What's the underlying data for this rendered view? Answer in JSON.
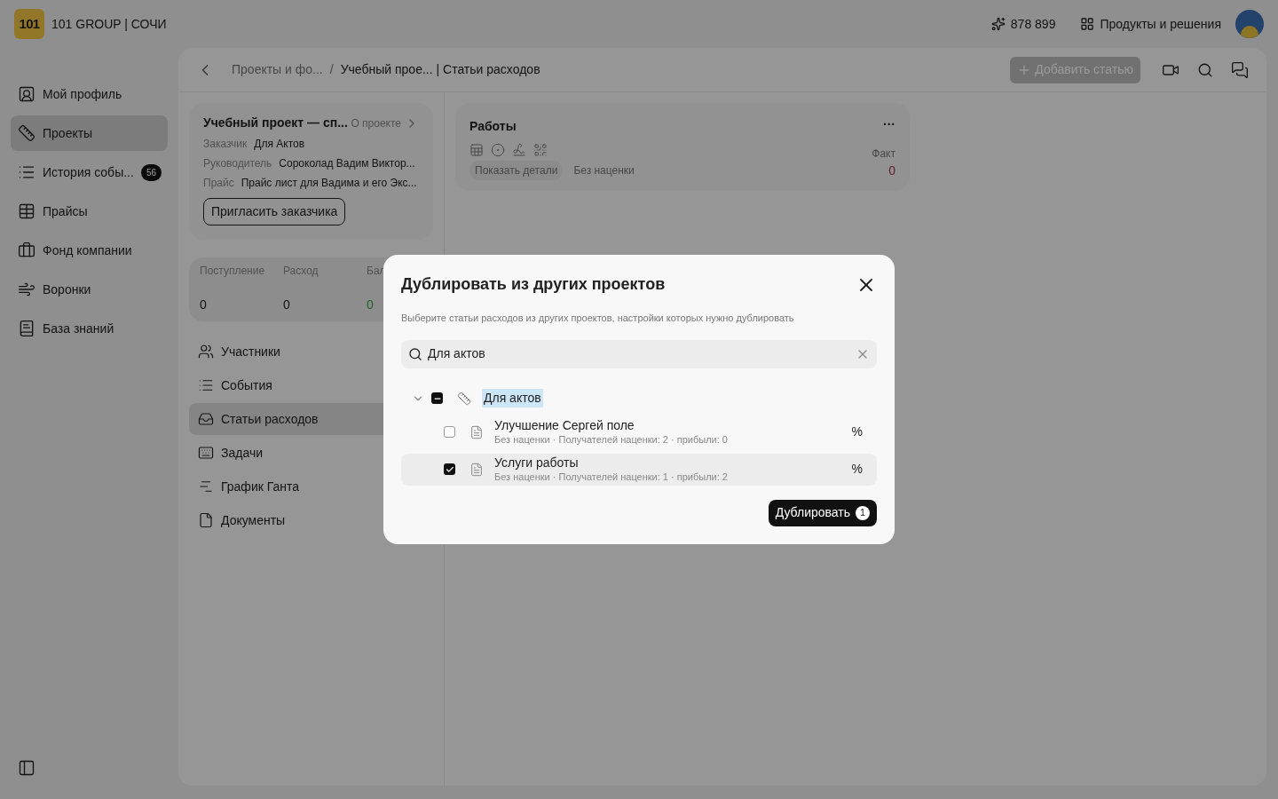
{
  "topbar": {
    "logo": "101",
    "brand": "101 GROUP | СОЧИ",
    "balance": "878 899",
    "products": "Продукты и решения"
  },
  "sidebar": {
    "items": [
      {
        "label": "Мой профиль",
        "selected": false
      },
      {
        "label": "Проекты",
        "selected": true
      },
      {
        "label": "История собы...",
        "selected": false,
        "badge": "56"
      },
      {
        "label": "Прайсы",
        "selected": false
      },
      {
        "label": "Фонд компании",
        "selected": false
      },
      {
        "label": "Воронки",
        "selected": false
      },
      {
        "label": "База знаний",
        "selected": false
      }
    ]
  },
  "header": {
    "breadcrumbs": [
      "Проекты и фо...",
      "Учебный прое... | Статьи расходов"
    ],
    "separator": "/",
    "add_button": "Добавить статью"
  },
  "project": {
    "title": "Учебный проект — сп...",
    "about": "О проекте",
    "fields": [
      {
        "label": "Заказчик",
        "value": "Для Актов"
      },
      {
        "label": "Руководитель",
        "value": "Сороколад Вадим Виктор..."
      },
      {
        "label": "Прайс",
        "value": "Прайс лист для Вадима и его Экс..."
      }
    ],
    "invite": "Пригласить заказчика"
  },
  "stats": [
    {
      "label": "Поступление",
      "value": "0",
      "kind": "plain"
    },
    {
      "label": "Расход",
      "value": "0",
      "kind": "plain"
    },
    {
      "label": "Бал",
      "value": "0",
      "kind": "positive"
    }
  ],
  "project_nav": [
    {
      "label": "Участники",
      "selected": false
    },
    {
      "label": "События",
      "selected": false
    },
    {
      "label": "Статьи расходов",
      "selected": true
    },
    {
      "label": "Задачи",
      "selected": false
    },
    {
      "label": "График Ганта",
      "selected": false
    },
    {
      "label": "Документы",
      "selected": false
    }
  ],
  "work_card": {
    "title": "Работы",
    "menu": "···",
    "tags": [
      "Показать детали",
      "Без наценки"
    ],
    "fact_label": "Факт",
    "fact_value": "0"
  },
  "dialog": {
    "title": "Дублировать из других проектов",
    "description": "Выберите статьи расходов из других проектов, настройки которых нужно дублировать",
    "search": {
      "value": "Для актов"
    },
    "tree": [
      {
        "label": "Для актов",
        "expanded": true,
        "indeterminate": true,
        "highlighted": true,
        "children": [
          {
            "title": "Улучшение Сергей поле",
            "meta": "Без наценки · Получателей наценки: 2 · прибыли: 0",
            "suffix": "%",
            "checked": false,
            "selected": false
          },
          {
            "title": "Услуги работы",
            "meta": "Без наценки · Получателей наценки: 1 · прибыли: 2",
            "suffix": "%",
            "checked": true,
            "selected": true
          }
        ]
      }
    ],
    "submit": "Дублировать",
    "count": "1"
  }
}
